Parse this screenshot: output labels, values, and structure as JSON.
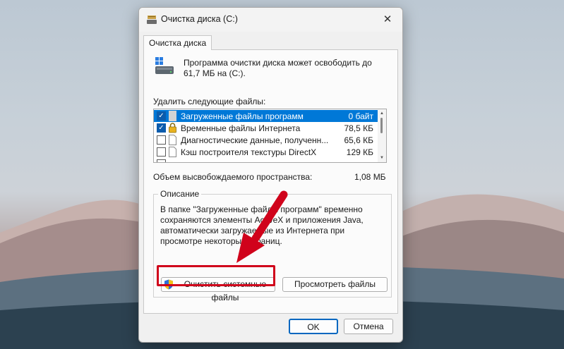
{
  "window": {
    "title": "Очистка диска  (C:)",
    "close_glyph": "✕",
    "tab_label": "Очистка диска"
  },
  "intro": "Программа очистки диска может освободить до 61,7 МБ на  (C:).",
  "files_label": "Удалить следующие файлы:",
  "files": [
    {
      "name": "Загруженные файлы программ",
      "size": "0 байт",
      "checked": true,
      "selected": true,
      "icon": "blank-file-icon"
    },
    {
      "name": "Временные файлы Интернета",
      "size": "78,5 КБ",
      "checked": true,
      "selected": false,
      "icon": "lock-icon"
    },
    {
      "name": "Диагностические данные, полученн...",
      "size": "65,6 КБ",
      "checked": false,
      "selected": false,
      "icon": "file-icon"
    },
    {
      "name": "Кэш построителя текстуры DirectX",
      "size": "129 КБ",
      "checked": false,
      "selected": false,
      "icon": "file-icon"
    }
  ],
  "space": {
    "label": "Объем высвобождаемого пространства:",
    "value": "1,08 МБ"
  },
  "description": {
    "legend": "Описание",
    "text": "В папке \"Загруженные файлы программ\" временно сохраняются элементы ActiveX и приложения Java, автоматически загружаемые из Интернета при просмотре некоторых страниц."
  },
  "buttons": {
    "clean_system": "Очистить системные файлы",
    "view_files": "Просмотреть файлы",
    "ok": "OK",
    "cancel": "Отмена"
  },
  "colors": {
    "selection": "#0078d7",
    "highlight": "#d0021b",
    "accent": "#0067c0"
  }
}
